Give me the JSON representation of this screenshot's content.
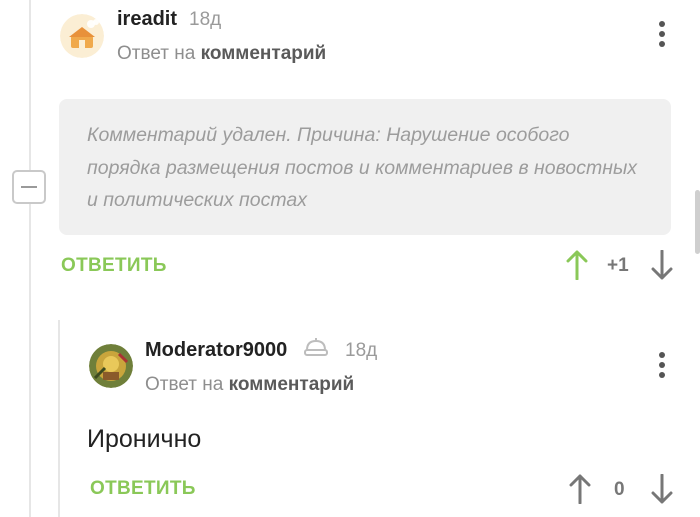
{
  "comments": [
    {
      "username": "ireadit",
      "time": "18д",
      "reply_prefix": "Ответ на",
      "reply_target": "комментарий",
      "deleted_text": "Комментарий удален. Причина: Нарушение особого порядка размещения постов и комментариев в новостных и политических постах",
      "reply_label": "ОТВЕТИТЬ",
      "rating": "+1",
      "upvoted": true
    },
    {
      "username": "Moderator9000",
      "badge_icon": "moderator-hat-icon",
      "time": "18д",
      "reply_prefix": "Ответ на",
      "reply_target": "комментарий",
      "text": "Иронично",
      "reply_label": "ОТВЕТИТЬ",
      "rating": "0",
      "upvoted": false
    }
  ],
  "colors": {
    "accent_green": "#8ac858",
    "muted_text": "#9a9a9a",
    "deleted_bg": "#f0f0f0"
  }
}
